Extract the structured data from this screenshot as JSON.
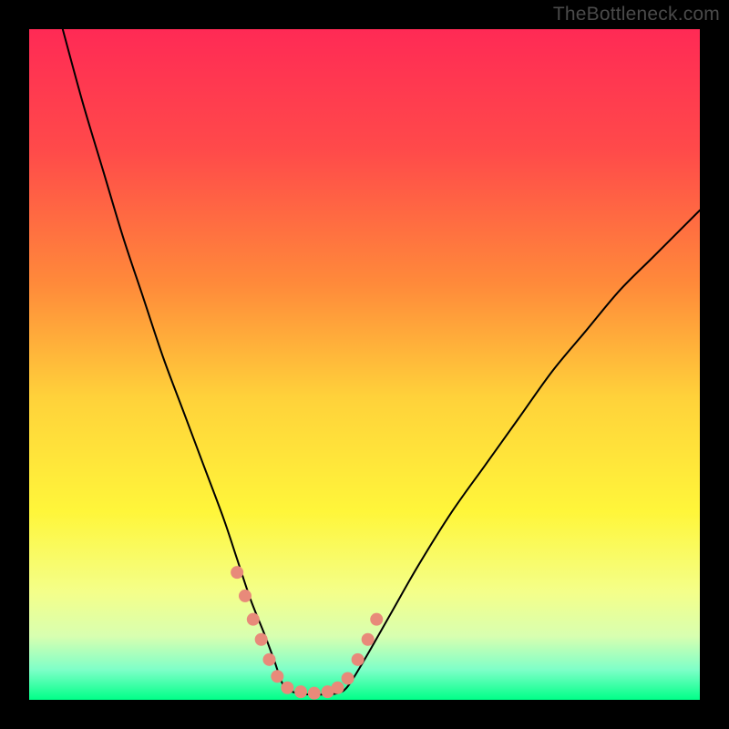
{
  "watermark": "TheBottleneck.com",
  "chart_data": {
    "type": "line",
    "title": "",
    "xlabel": "",
    "ylabel": "",
    "xlim": [
      0,
      100
    ],
    "ylim": [
      0,
      100
    ],
    "grid": false,
    "legend": false,
    "background_gradient_stops": [
      {
        "offset": 0.0,
        "color": "#ff2a55"
      },
      {
        "offset": 0.18,
        "color": "#ff4a4a"
      },
      {
        "offset": 0.38,
        "color": "#ff8a3a"
      },
      {
        "offset": 0.55,
        "color": "#ffd23a"
      },
      {
        "offset": 0.72,
        "color": "#fff63a"
      },
      {
        "offset": 0.84,
        "color": "#f4ff8a"
      },
      {
        "offset": 0.905,
        "color": "#d8ffb0"
      },
      {
        "offset": 0.955,
        "color": "#7effc8"
      },
      {
        "offset": 1.0,
        "color": "#00ff88"
      }
    ],
    "series": [
      {
        "name": "left-curve",
        "x": [
          5,
          8,
          11,
          14,
          17,
          20,
          23,
          26,
          29,
          31,
          33,
          35,
          36.5,
          38
        ],
        "y": [
          100,
          89,
          79,
          69,
          60,
          51,
          43,
          35,
          27,
          21,
          15,
          10,
          6,
          2
        ]
      },
      {
        "name": "valley-floor",
        "x": [
          38,
          40,
          42,
          44,
          46,
          47.5
        ],
        "y": [
          2,
          1,
          0.8,
          0.8,
          1,
          2
        ]
      },
      {
        "name": "right-curve",
        "x": [
          47.5,
          50,
          54,
          58,
          63,
          68,
          73,
          78,
          83,
          88,
          93,
          98,
          100
        ],
        "y": [
          2,
          6,
          13,
          20,
          28,
          35,
          42,
          49,
          55,
          61,
          66,
          71,
          73
        ]
      }
    ],
    "marker_cluster": {
      "name": "valley-markers",
      "color": "#e88a7a",
      "radius_css_px": 7,
      "points": [
        {
          "x": 31.0,
          "y": 19.0
        },
        {
          "x": 32.2,
          "y": 15.5
        },
        {
          "x": 33.4,
          "y": 12.0
        },
        {
          "x": 34.6,
          "y": 9.0
        },
        {
          "x": 35.8,
          "y": 6.0
        },
        {
          "x": 37.0,
          "y": 3.5
        },
        {
          "x": 38.5,
          "y": 1.8
        },
        {
          "x": 40.5,
          "y": 1.2
        },
        {
          "x": 42.5,
          "y": 1.0
        },
        {
          "x": 44.5,
          "y": 1.2
        },
        {
          "x": 46.0,
          "y": 1.8
        },
        {
          "x": 47.5,
          "y": 3.2
        },
        {
          "x": 49.0,
          "y": 6.0
        },
        {
          "x": 50.5,
          "y": 9.0
        },
        {
          "x": 51.8,
          "y": 12.0
        }
      ]
    }
  }
}
